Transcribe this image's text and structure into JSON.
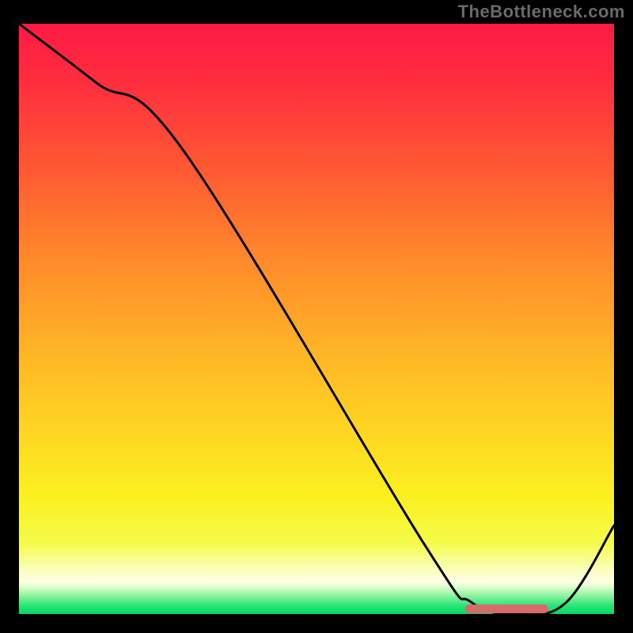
{
  "watermark": "TheBottleneck.com",
  "chart_data": {
    "type": "line",
    "title": "",
    "xlabel": "",
    "ylabel": "",
    "xlim": [
      0,
      100
    ],
    "ylim": [
      0,
      100
    ],
    "x": [
      0,
      13,
      28,
      68,
      76,
      84,
      92,
      100
    ],
    "values": [
      100,
      90,
      78,
      12,
      2,
      0,
      2,
      15
    ],
    "optimal_range": {
      "start": 75,
      "end": 89
    },
    "gradient_stops": [
      {
        "pos": 0.0,
        "color": "#ff1a44"
      },
      {
        "pos": 0.1,
        "color": "#ff2e3e"
      },
      {
        "pos": 0.25,
        "color": "#ff5a33"
      },
      {
        "pos": 0.4,
        "color": "#ff8a2a"
      },
      {
        "pos": 0.55,
        "color": "#ffb327"
      },
      {
        "pos": 0.7,
        "color": "#ffd823"
      },
      {
        "pos": 0.8,
        "color": "#fbf01f"
      },
      {
        "pos": 0.88,
        "color": "#f5fb4a"
      },
      {
        "pos": 0.92,
        "color": "#f9ffb0"
      },
      {
        "pos": 0.945,
        "color": "#ffffe6"
      },
      {
        "pos": 0.955,
        "color": "#d8ffc8"
      },
      {
        "pos": 0.97,
        "color": "#86f29c"
      },
      {
        "pos": 0.985,
        "color": "#2de57a"
      },
      {
        "pos": 1.0,
        "color": "#00d864"
      }
    ],
    "optimal_bar_color": "#d86a6c"
  }
}
